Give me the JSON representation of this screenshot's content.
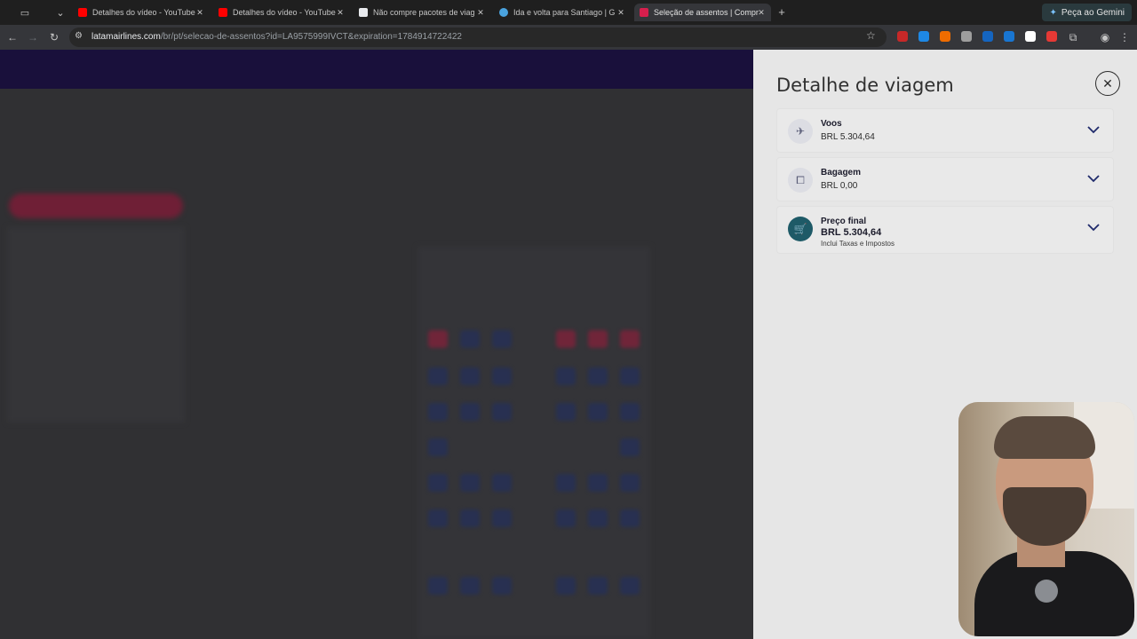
{
  "browser": {
    "tabs": [
      {
        "title": "Detalhes do vídeo - YouTube",
        "favicon_color": "#ff0000",
        "active": false
      },
      {
        "title": "Detalhes do vídeo - YouTube",
        "favicon_color": "#ff0000",
        "active": false
      },
      {
        "title": "Não compre pacotes de viag",
        "favicon_color": "#e8eaed",
        "active": false
      },
      {
        "title": "Ida e volta para Santiago | G",
        "favicon_color": "#4aa3df",
        "active": false
      },
      {
        "title": "Seleção de assentos | Compr",
        "favicon_color": "#d61f4d",
        "active": true
      }
    ],
    "gemini_label": "Peça ao Gemini",
    "url_host": "latamairlines.com",
    "url_path": "/br/pt/selecao-de-assentos?id=LA9575999IVCT&expiration=1784914722422",
    "extension_colors": [
      "#c62828",
      "#1e88e5",
      "#ef6c00",
      "#9e9e9e",
      "#1565c0",
      "#1976d2",
      "#ffffff",
      "#e53935",
      "#9e9e9e",
      "#8d6e63"
    ]
  },
  "panel": {
    "title": "Detalhe de viagem",
    "items": [
      {
        "icon": "plane-icon",
        "label": "Voos",
        "value": "BRL 5.304,64"
      },
      {
        "icon": "luggage-icon",
        "label": "Bagagem",
        "value": "BRL 0,00"
      },
      {
        "icon": "cart-icon",
        "label": "Preço final",
        "value": "BRL 5.304,64",
        "note": "Inclui Taxas e Impostos"
      }
    ]
  },
  "colors": {
    "latam_header": "#1b0f47",
    "panel_background": "#e6e6e6",
    "final_price_icon": "#1e5a67"
  }
}
